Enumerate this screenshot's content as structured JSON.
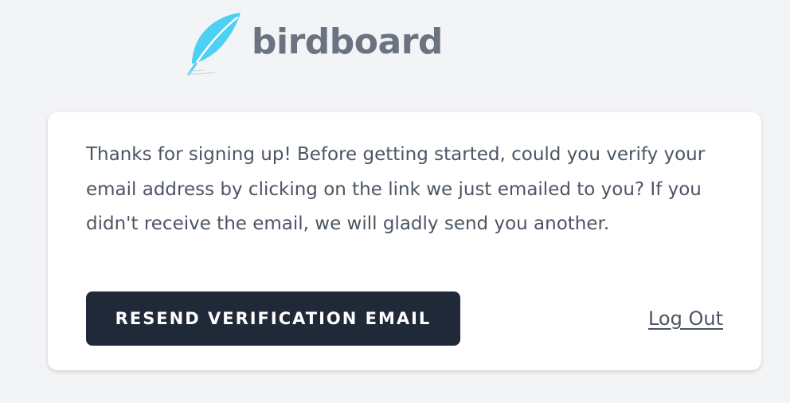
{
  "brand": {
    "name": "birdboard",
    "icon": "feather-icon",
    "icon_color": "#4dd0f2",
    "text_color": "#6b7280"
  },
  "verify_card": {
    "message": "Thanks for signing up! Before getting started, could you verify your email address by clicking on the link we just emailed to you? If you didn't receive the email, we will gladly send you another.",
    "resend_button_label": "RESEND VERIFICATION EMAIL",
    "logout_label": "Log Out"
  },
  "colors": {
    "background": "#f3f4f6",
    "card": "#ffffff",
    "button": "#1f2937",
    "text": "#4b5563"
  }
}
